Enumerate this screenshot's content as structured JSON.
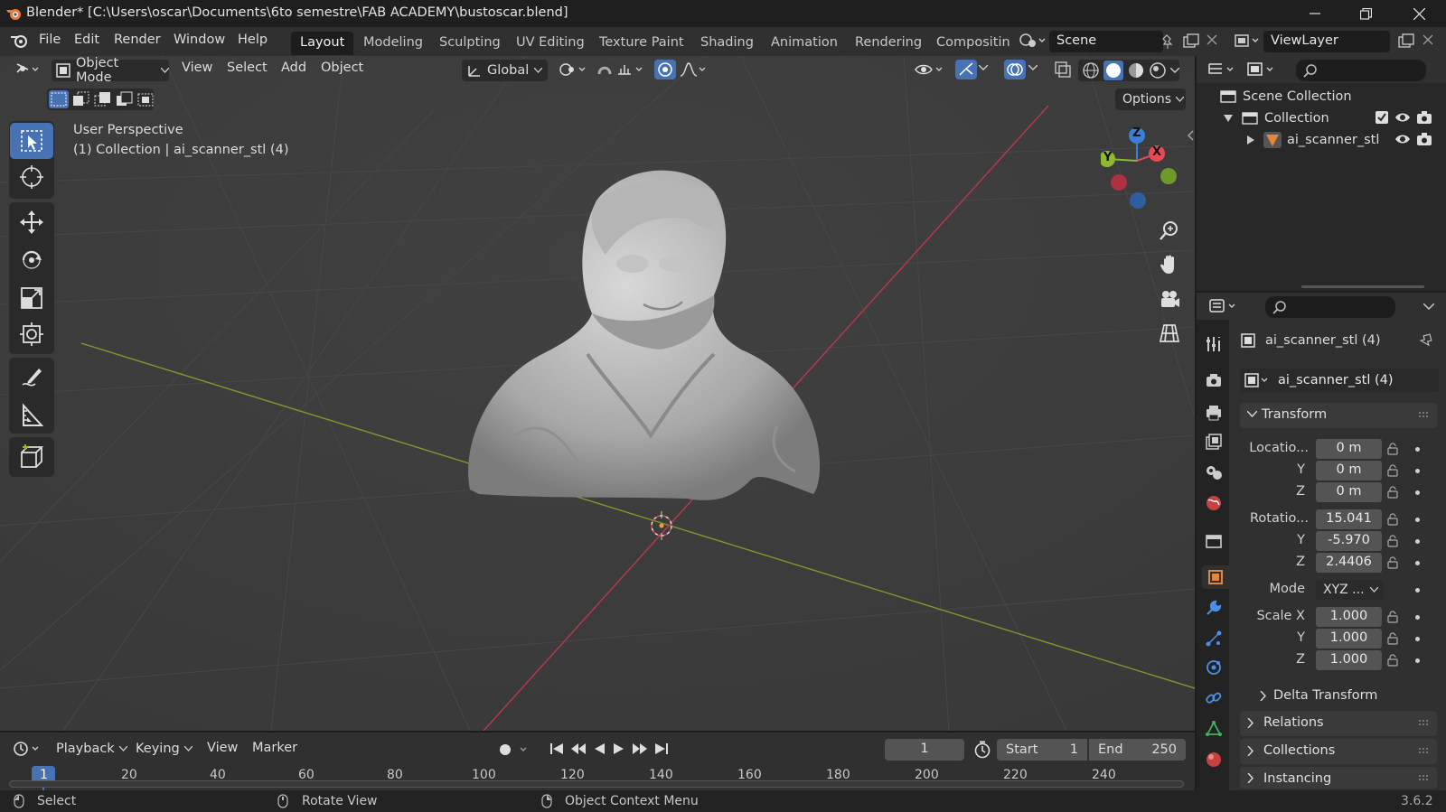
{
  "window": {
    "title": "Blender* [C:\\Users\\oscar\\Documents\\6to semestre\\FAB ACADEMY\\bustoscar.blend]",
    "controls": [
      "minimize-icon",
      "restore-icon",
      "close-icon"
    ]
  },
  "menu": {
    "items": [
      "File",
      "Edit",
      "Render",
      "Window",
      "Help"
    ]
  },
  "workspaces": [
    "Layout",
    "Modeling",
    "Sculpting",
    "UV Editing",
    "Texture Paint",
    "Shading",
    "Animation",
    "Rendering",
    "Compositin"
  ],
  "active_workspace": "Layout",
  "scene": {
    "name": "Scene",
    "view_layer": "ViewLayer"
  },
  "viewport_header": {
    "mode": "Object Mode",
    "menus": [
      "View",
      "Select",
      "Add",
      "Object"
    ],
    "transform_orientation": "Global",
    "options": "Options"
  },
  "viewport": {
    "perspective": "User Perspective",
    "context": "(1) Collection | ai_scanner_stl (4)",
    "gizmo_labels": {
      "z": "Z",
      "y": "Y",
      "x": "X"
    }
  },
  "tools": [
    "select-box-icon",
    "cursor-icon",
    "move-icon",
    "rotate-icon",
    "scale-icon",
    "transform-icon",
    "annotate-icon",
    "measure-icon",
    "add-cube-icon"
  ],
  "outliner": {
    "root": "Scene Collection",
    "collection": "Collection",
    "object": "ai_scanner_stl"
  },
  "properties": {
    "object_name": "ai_scanner_stl (4)",
    "data_name": "ai_scanner_stl (4)",
    "transform_label": "Transform",
    "location_label": "Locatio...",
    "location": {
      "x": "0 m",
      "y": "0 m",
      "z": "0 m"
    },
    "rotation_label": "Rotatio...",
    "rotation": {
      "x": "15.041",
      "y": "-5.970",
      "z": "2.4406"
    },
    "mode_label": "Mode",
    "mode": "XYZ ...",
    "scale_label": "Scale X",
    "scale": {
      "x": "1.000",
      "y": "1.000",
      "z": "1.000"
    },
    "axis_y": "Y",
    "axis_z": "Z",
    "sections": [
      "Delta Transform",
      "Relations",
      "Collections",
      "Instancing"
    ]
  },
  "timeline": {
    "menus": [
      "Playback",
      "Keying",
      "View",
      "Marker"
    ],
    "current_frame": "1",
    "start_label": "Start",
    "start": "1",
    "end_label": "End",
    "end": "250",
    "ticks": [
      "1",
      "20",
      "40",
      "60",
      "80",
      "100",
      "120",
      "140",
      "160",
      "180",
      "200",
      "220",
      "240"
    ]
  },
  "status": {
    "items": [
      "Select",
      "Rotate View",
      "Object Context Menu"
    ],
    "version": "3.6.2"
  },
  "colors": {
    "accent": "#4772b3",
    "x_axis": "#e54a5a",
    "y_axis": "#8cba30",
    "z_axis": "#3c7fd8",
    "object_orange": "#e8843a"
  }
}
